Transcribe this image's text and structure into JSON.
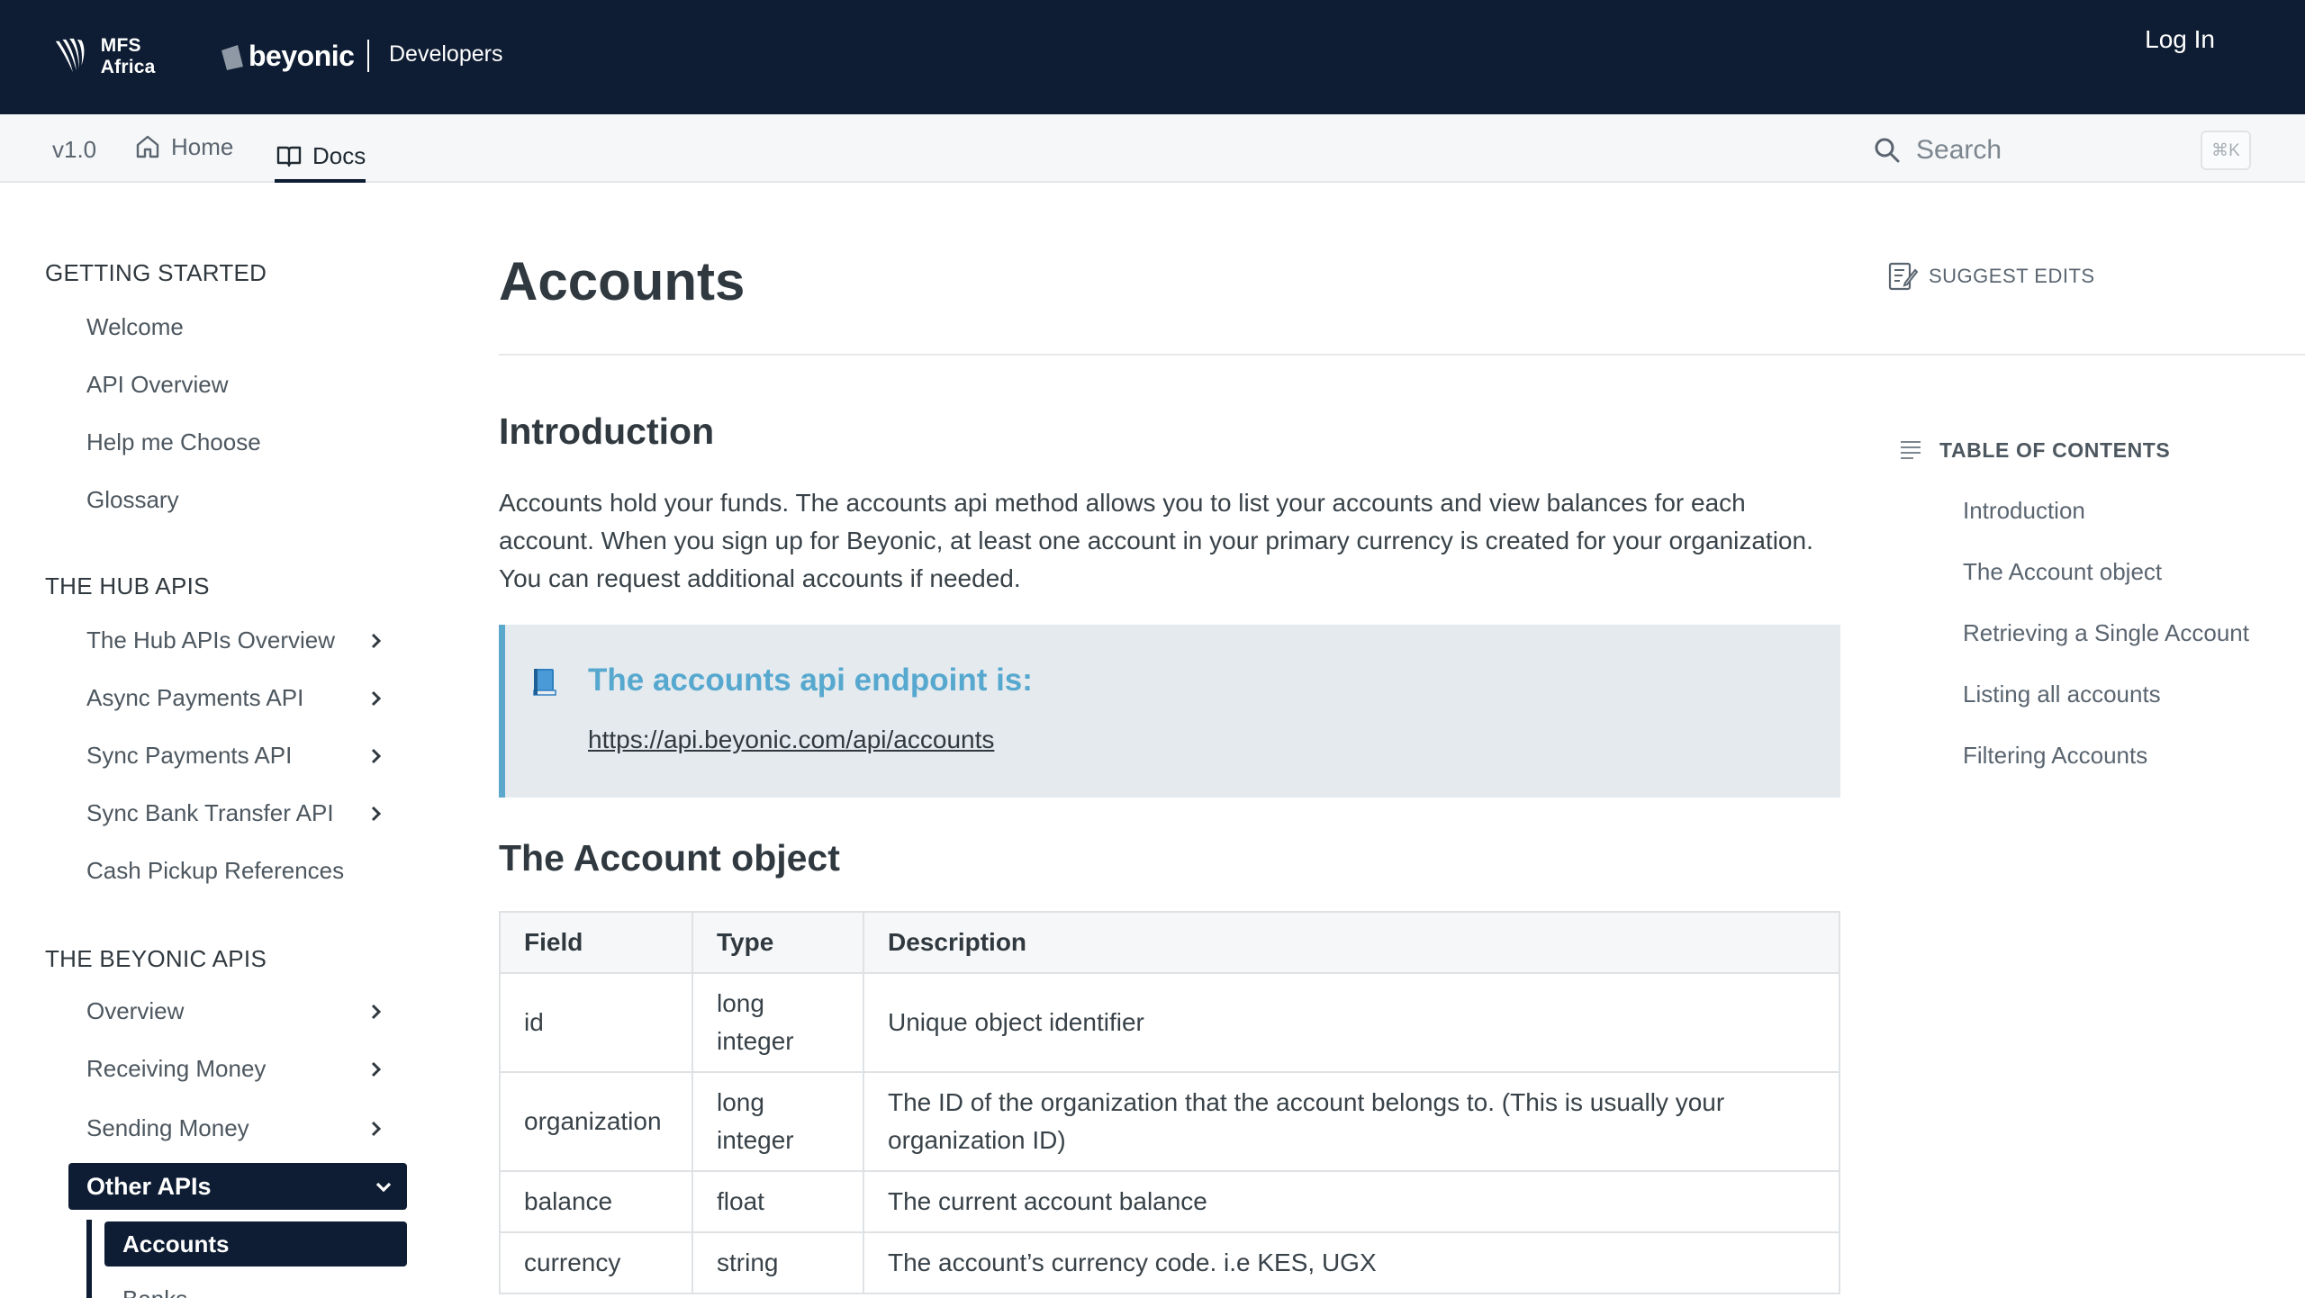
{
  "header": {
    "brand_mfs": "MFS Africa",
    "brand_beyonic": "beyonic",
    "section": "Developers",
    "login_label": "Log In"
  },
  "subnav": {
    "version": "v1.0",
    "home_label": "Home",
    "docs_label": "Docs",
    "search_placeholder": "Search",
    "search_shortcut": "⌘K"
  },
  "sidebar": {
    "sections": [
      {
        "heading": "GETTING STARTED",
        "items": [
          "Welcome",
          "API Overview",
          "Help me Choose",
          "Glossary"
        ]
      },
      {
        "heading": "THE HUB APIS",
        "items": [
          "The Hub APIs Overview",
          "Async Payments API",
          "Sync Payments API",
          "Sync Bank Transfer API",
          "Cash Pickup References"
        ]
      },
      {
        "heading": "THE BEYONIC APIS",
        "items": [
          "Overview",
          "Receiving Money",
          "Sending Money"
        ]
      }
    ],
    "active_group": "Other APIs",
    "active_item": "Accounts",
    "next_item_partial": "Banks"
  },
  "main": {
    "title": "Accounts",
    "suggest_edits": "SUGGEST EDITS",
    "intro_heading": "Introduction",
    "intro_text": "Accounts hold your funds. The accounts api method allows you to list your accounts and view balances for each account. When you sign up for Beyonic, at least one account in your primary currency is created for your organization. You can request additional accounts if needed.",
    "callout_icon": "📘",
    "callout_title": "The accounts api endpoint is:",
    "callout_link": "https://api.beyonic.com/api/accounts",
    "object_heading": "The Account object",
    "table": {
      "headers": [
        "Field",
        "Type",
        "Description"
      ],
      "rows": [
        [
          "id",
          "long integer",
          "Unique object identifier"
        ],
        [
          "organization",
          "long integer",
          "The ID of the organization that the account belongs to. (This is usually your organization ID)"
        ],
        [
          "balance",
          "float",
          "The current account balance"
        ],
        [
          "currency",
          "string",
          "The account’s currency code. i.e KES, UGX"
        ]
      ]
    }
  },
  "toc": {
    "heading": "TABLE OF CONTENTS",
    "items": [
      "Introduction",
      "The Account object",
      "Retrieving a Single Account",
      "Listing all accounts",
      "Filtering Accounts"
    ]
  }
}
